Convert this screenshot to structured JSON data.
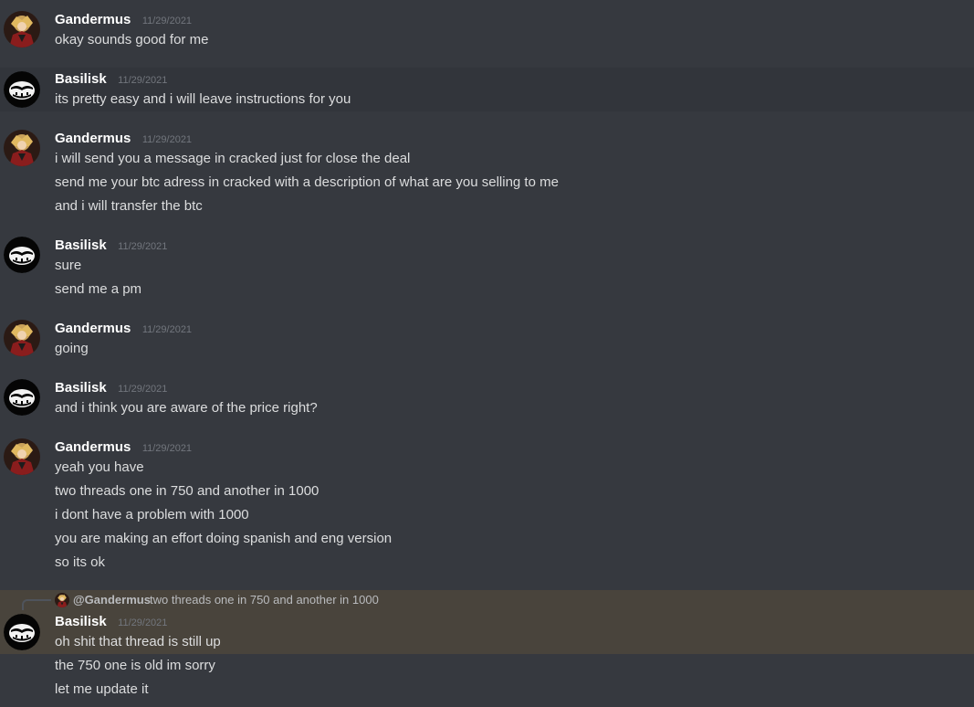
{
  "users": {
    "gandermus": {
      "name": "Gandermus",
      "avatar_icon": "anime-character-avatar-icon"
    },
    "basilisk": {
      "name": "Basilisk",
      "avatar_icon": "smiling-mask-avatar-icon"
    }
  },
  "messages": [
    {
      "author": "Gandermus",
      "timestamp": "11/29/2021",
      "lines": [
        "okay sounds good for me"
      ]
    },
    {
      "author": "Basilisk",
      "timestamp": "11/29/2021",
      "lines": [
        "its pretty easy and i will leave instructions for you"
      ]
    },
    {
      "author": "Gandermus",
      "timestamp": "11/29/2021",
      "lines": [
        "i will send you a message in cracked just for close the deal",
        "send me your btc adress in cracked with a description of what are you selling to me",
        "and i will transfer the btc"
      ]
    },
    {
      "author": "Basilisk",
      "timestamp": "11/29/2021",
      "lines": [
        "sure",
        "send me a pm"
      ]
    },
    {
      "author": "Gandermus",
      "timestamp": "11/29/2021",
      "lines": [
        "going"
      ]
    },
    {
      "author": "Basilisk",
      "timestamp": "11/29/2021",
      "lines": [
        "and i think you are aware of the price right?"
      ]
    },
    {
      "author": "Gandermus",
      "timestamp": "11/29/2021",
      "lines": [
        "yeah you have",
        "two threads one in 750 and another in 1000",
        "i dont have a problem with 1000",
        "you are making an effort doing spanish and eng version",
        "so its ok"
      ]
    },
    {
      "author": "Basilisk",
      "timestamp": "11/29/2021",
      "reply": {
        "user": "@Gandermus",
        "text": "two threads one in 750 and another in 1000"
      },
      "lines": [
        "oh shit that thread is still up",
        "the 750 one is old im sorry",
        "let me update it"
      ]
    }
  ],
  "colors": {
    "background": "#36393f",
    "hover_row": "#32353b",
    "mention_row": "#49443c",
    "username": "#ffffff",
    "timestamp": "#72767d",
    "text": "#dcddde"
  }
}
